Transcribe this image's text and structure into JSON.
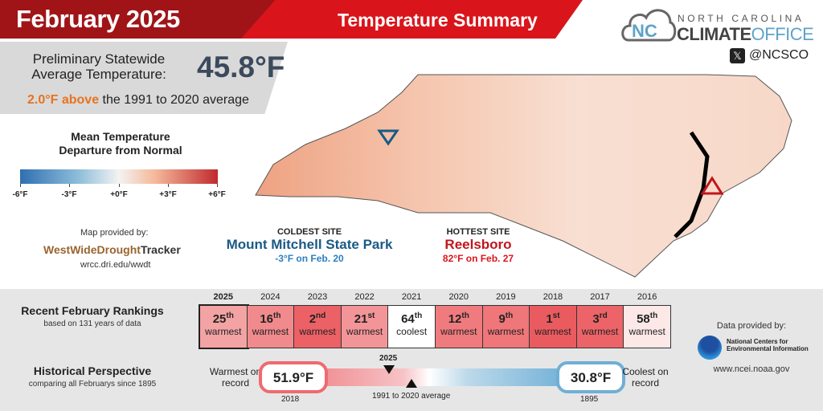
{
  "header": {
    "title": "February 2025",
    "subtitle": "Temperature Summary"
  },
  "stat": {
    "label": "Preliminary Statewide Average Temperature:",
    "value": "45.8°F",
    "anomaly_value": "2.0°F above",
    "anomaly_rest": " the 1991 to 2020 average"
  },
  "legend": {
    "title": "Mean Temperature Departure from Normal",
    "ticks": [
      "-6°F",
      "-3°F",
      "+0°F",
      "+3°F",
      "+6°F"
    ],
    "colors": [
      "#2f6fb2",
      "#f3f3f3",
      "#c02a2e"
    ]
  },
  "credit": {
    "label": "Map provided by:",
    "brand_a": "WestWideDrought",
    "brand_b": "Tracker",
    "url": "wrcc.dri.edu/wwdt"
  },
  "coldest": {
    "header": "COLDEST SITE",
    "name": "Mount Mitchell State Park",
    "detail": "-3°F on Feb. 20",
    "color": "#1a5a86"
  },
  "hottest": {
    "header": "HOTTEST SITE",
    "name": "Reelsboro",
    "detail": "82°F on Feb. 27",
    "color": "#c0161c"
  },
  "logo": {
    "line1": "NORTH CAROLINA",
    "climate": "CLIMATE",
    "office": "OFFICE",
    "handle": "@NCSCO"
  },
  "rankings": {
    "title": "Recent February Rankings",
    "subtitle": "based on 131 years of data",
    "items": [
      {
        "year": "2025",
        "num": "25",
        "suf": "th",
        "word": "warmest",
        "color": "#f3a3a3"
      },
      {
        "year": "2024",
        "num": "16",
        "suf": "th",
        "word": "warmest",
        "color": "#f18a8c"
      },
      {
        "year": "2023",
        "num": "2",
        "suf": "nd",
        "word": "warmest",
        "color": "#ec6166"
      },
      {
        "year": "2022",
        "num": "21",
        "suf": "st",
        "word": "warmest",
        "color": "#f39598"
      },
      {
        "year": "2021",
        "num": "64",
        "suf": "th",
        "word": "coolest",
        "color": "#ffffff"
      },
      {
        "year": "2020",
        "num": "12",
        "suf": "th",
        "word": "warmest",
        "color": "#f07b7e"
      },
      {
        "year": "2019",
        "num": "9",
        "suf": "th",
        "word": "warmest",
        "color": "#ef7679"
      },
      {
        "year": "2018",
        "num": "1",
        "suf": "st",
        "word": "warmest",
        "color": "#ea5b60"
      },
      {
        "year": "2017",
        "num": "3",
        "suf": "rd",
        "word": "warmest",
        "color": "#ec6468"
      },
      {
        "year": "2016",
        "num": "58",
        "suf": "th",
        "word": "warmest",
        "color": "#fde8e8"
      }
    ]
  },
  "historical": {
    "title": "Historical Perspective",
    "subtitle": "comparing all Februarys since 1895",
    "warmest_label": "Warmest on record",
    "warmest_value": "51.9°F",
    "warmest_year": "2018",
    "coolest_label": "Coolest on record",
    "coolest_value": "30.8°F",
    "coolest_year": "1895",
    "marker_label": "2025",
    "average_label": "1991 to 2020 average"
  },
  "data_credit": {
    "label": "Data provided by:",
    "org_line1": "National Centers for",
    "org_line2": "Environmental Information",
    "url": "www.ncei.noaa.gov"
  }
}
